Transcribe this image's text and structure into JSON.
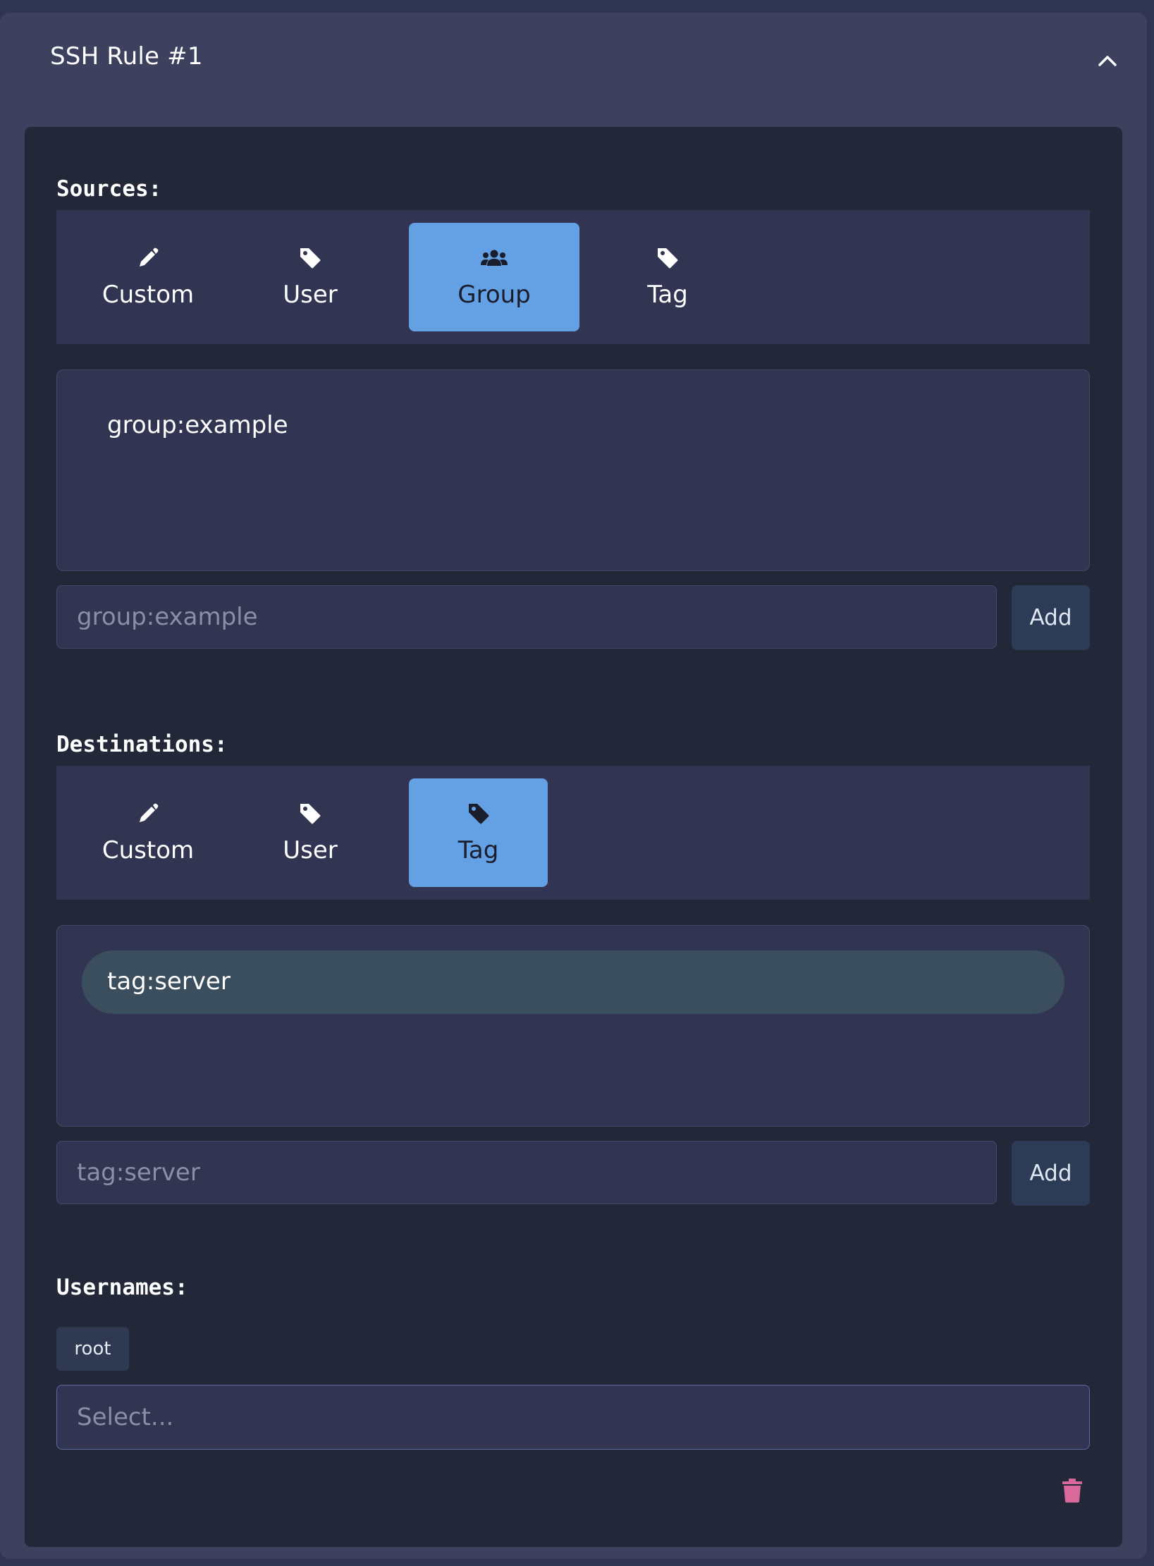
{
  "rule": {
    "title": "SSH Rule #1",
    "collapse_icon": "chevron-up-icon"
  },
  "sources": {
    "label": "Sources:",
    "tabs": [
      {
        "label": "Custom",
        "icon": "pencil-icon",
        "active": false
      },
      {
        "label": "User",
        "icon": "tag-icon",
        "active": false
      },
      {
        "label": "Group",
        "icon": "users-icon",
        "active": true
      },
      {
        "label": "Tag",
        "icon": "tag-icon",
        "active": false
      }
    ],
    "value_text": "group:example",
    "input_placeholder": "group:example",
    "add_label": "Add"
  },
  "destinations": {
    "label": "Destinations:",
    "tabs": [
      {
        "label": "Custom",
        "icon": "pencil-icon",
        "active": false
      },
      {
        "label": "User",
        "icon": "tag-icon",
        "active": false
      },
      {
        "label": "Tag",
        "icon": "tag-icon",
        "active": true
      }
    ],
    "chip_text": "tag:server",
    "input_placeholder": "tag:server",
    "add_label": "Add"
  },
  "usernames": {
    "label": "Usernames:",
    "selected": [
      "root"
    ],
    "select_placeholder": "Select..."
  },
  "delete_icon": "trash-icon",
  "colors": {
    "page_bg": "#303552",
    "panel_bg": "#3d415d",
    "body_bg": "#222838",
    "tab_active": "#64a0e4",
    "chip_bg": "#3b4e5d",
    "delete": "#d9689b"
  }
}
